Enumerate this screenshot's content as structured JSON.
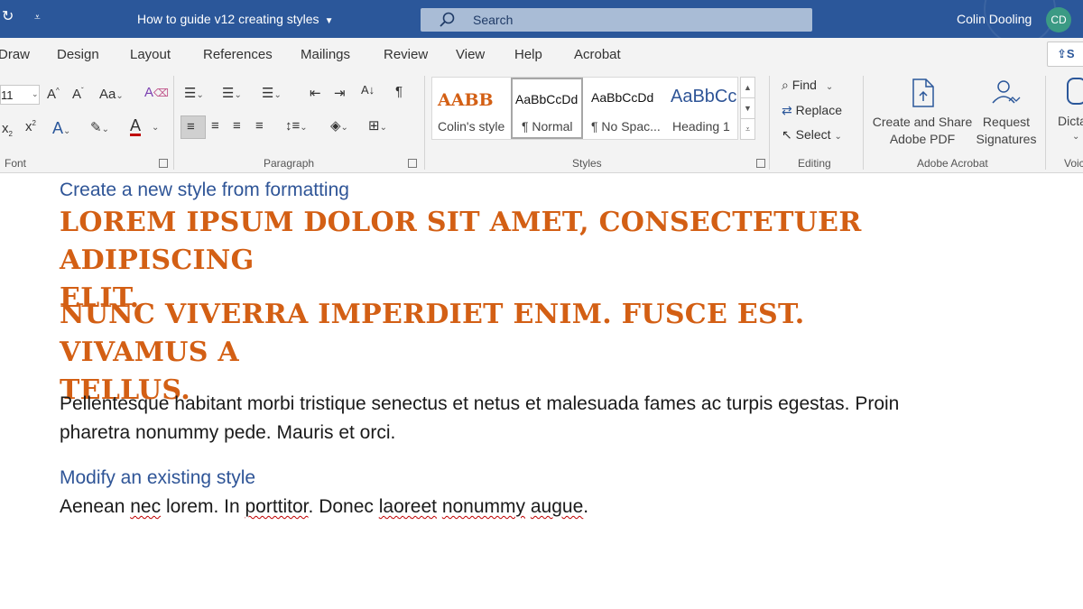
{
  "titlebar": {
    "doc_title": "How to guide v12 creating styles",
    "search_placeholder": "Search",
    "user_name": "Colin Dooling",
    "user_initials": "CD",
    "bg_color": "#2b579a"
  },
  "tabs": [
    "Draw",
    "Design",
    "Layout",
    "References",
    "Mailings",
    "Review",
    "View",
    "Help",
    "Acrobat"
  ],
  "share_label": "S",
  "ribbon": {
    "font": {
      "size_value": "11",
      "label": "Font"
    },
    "paragraph_label": "Paragraph",
    "styles": {
      "label": "Styles",
      "items": [
        {
          "sample": "AABB",
          "name": "Colin's style"
        },
        {
          "sample": "AaBbCcDd",
          "name": "¶ Normal"
        },
        {
          "sample": "AaBbCcDd",
          "name": "¶ No Spac..."
        },
        {
          "sample": "AaBbCc",
          "name": "Heading 1"
        }
      ]
    },
    "editing": {
      "label": "Editing",
      "find": "Find",
      "replace": "Replace",
      "select": "Select"
    },
    "acrobat": {
      "label": "Adobe Acrobat",
      "create_line1": "Create and Share",
      "create_line2": "Adobe PDF",
      "request_line1": "Request",
      "request_line2": "Signatures"
    },
    "voice": {
      "label": "Voic",
      "dictate": "Dicta"
    }
  },
  "document": {
    "heading1": "Create a new style from formatting",
    "styled_para1_line1": "LOREM IPSUM DOLOR SIT AMET, CONSECTETUER ADIPISCING",
    "styled_para1_line2": "ELIT.",
    "styled_para2_line1": "NUNC VIVERRA IMPERDIET ENIM. FUSCE EST. VIVAMUS A",
    "styled_para2_line2": "TELLUS.",
    "body1_line1": "Pellentesque habitant morbi tristique senectus et netus et malesuada fames ac turpis egestas. Proin",
    "body1_line2": "pharetra nonummy pede. Mauris et orci.",
    "heading2": "Modify an existing style",
    "body2_a": "Aenean ",
    "body2_b": "nec",
    "body2_c": " lorem. In ",
    "body2_d": "porttitor",
    "body2_e": ". Donec ",
    "body2_f": "laoreet",
    "body2_g": " ",
    "body2_h": "nonummy",
    "body2_i": " ",
    "body2_j": "augue",
    "body2_k": ".",
    "accent_orange": "#d35f14",
    "heading_blue": "#2f5597"
  }
}
